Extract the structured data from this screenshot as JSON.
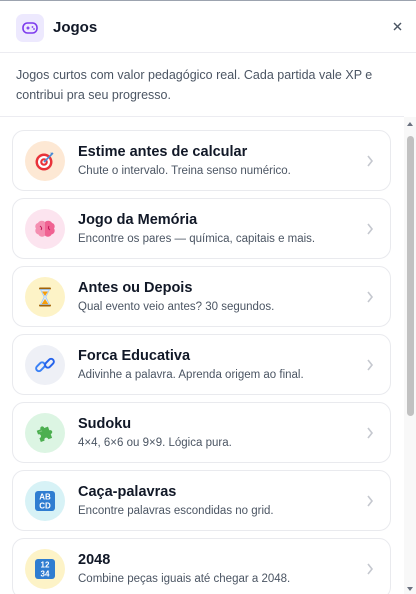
{
  "header": {
    "title": "Jogos",
    "icon": "gamepad-icon",
    "close_label": "×"
  },
  "description": "Jogos curtos com valor pedagógico real. Cada partida vale XP e contribui pra seu progresso.",
  "games": [
    {
      "title": "Estime antes de calcular",
      "subtitle": "Chute o intervalo. Treina senso numérico.",
      "icon": "target-icon",
      "icon_bg": "#fde8d4"
    },
    {
      "title": "Jogo da Memória",
      "subtitle": "Encontre os pares — química, capitais e mais.",
      "icon": "brain-icon",
      "icon_bg": "#fce4ef"
    },
    {
      "title": "Antes ou Depois",
      "subtitle": "Qual evento veio antes? 30 segundos.",
      "icon": "hourglass-icon",
      "icon_bg": "#fdf3c7"
    },
    {
      "title": "Forca Educativa",
      "subtitle": "Adivinhe a palavra. Aprenda origem ao final.",
      "icon": "chain-icon",
      "icon_bg": "#eef0f6"
    },
    {
      "title": "Sudoku",
      "subtitle": "4×4, 6×6 ou 9×9. Lógica pura.",
      "icon": "puzzle-icon",
      "icon_bg": "#dcf5e3"
    },
    {
      "title": "Caça-palavras",
      "subtitle": "Encontre palavras escondidas no grid.",
      "icon": "abcd-icon",
      "icon_bg": "#d7f2f6",
      "icon_text": "AB CD"
    },
    {
      "title": "2048",
      "subtitle": "Combine peças iguais até chegar a 2048.",
      "icon": "numbers-1234-icon",
      "icon_bg": "#fdf3c7",
      "icon_text": "12 34"
    }
  ]
}
